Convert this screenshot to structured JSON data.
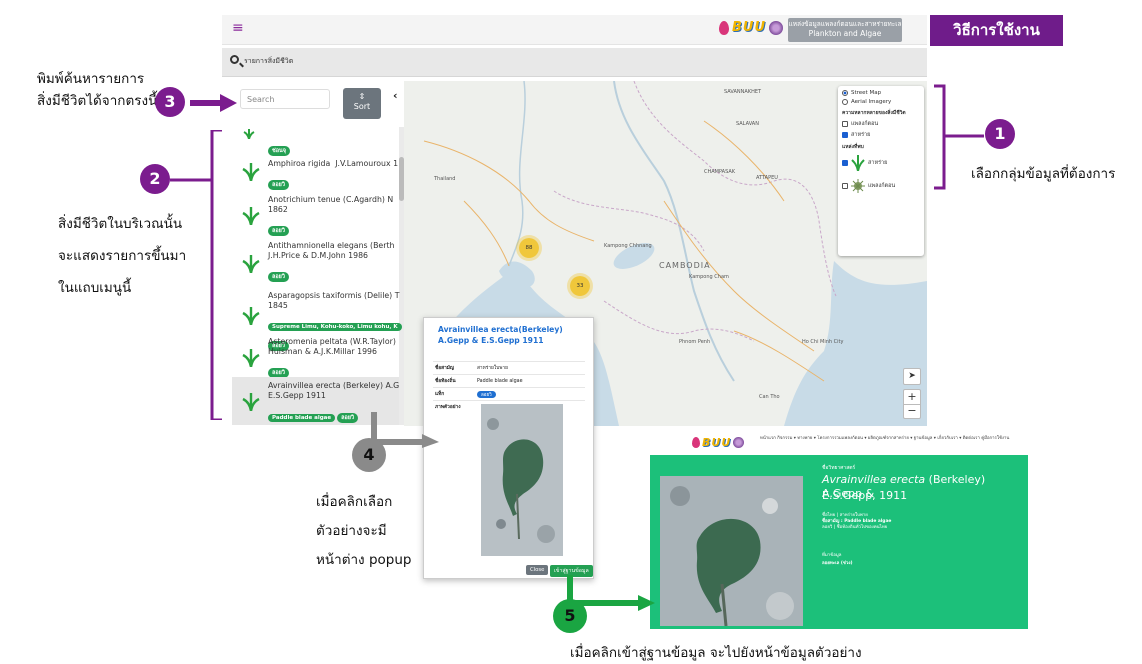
{
  "header": {
    "menu_icon": "hamburger-icon",
    "logo_text": "BUU",
    "db_button_line1": "แหล่งข้อมูลแพลงก์ตอนและสาหร่ายทะเล",
    "db_button_line2": "Plankton and Algae",
    "how_to_title": "วิธีการใช้งาน"
  },
  "search_bar": {
    "label": "รายการสิ่งมีชีวิต"
  },
  "sidebar": {
    "search_placeholder": "Search",
    "sort_icon": "⇕",
    "sort_label": "Sort",
    "collapse_icon": "‹",
    "items": [
      {
        "name": "",
        "tags": [
          "ช่อนจุ"
        ]
      },
      {
        "name": "Amphiroa rigida  J.V.Lamouroux 1",
        "tags": [
          "ลอยวิ"
        ]
      },
      {
        "name": "Anotrichium tenue (C.Agardh) N\n1862",
        "tags": [
          "ลอยวิ"
        ]
      },
      {
        "name": "Antithamnionella elegans (Berth\nJ.H.Price & D.M.John 1986",
        "tags": [
          "ลอยวิ"
        ]
      },
      {
        "name": "Asparagopsis taxiformis (Delile) T\n1845",
        "tags": [
          "Supreme Limu, Kohu-koko, Limu kohu, K",
          "ลอยวิ"
        ]
      },
      {
        "name": "Asteromenia peltata (W.R.Taylor)\nHuisman & A.J.K.Millar 1996",
        "tags": [
          "ลอยวิ"
        ]
      },
      {
        "name": "Avrainvillea erecta (Berkeley) A.G\nE.S.Gepp 1911",
        "tags": [
          "Paddle blade algae",
          "ลอยวิ"
        ]
      }
    ]
  },
  "map": {
    "labels": [
      "SAVANNAKHET",
      "SALAVAN",
      "CHAMPASAK",
      "ATTAPEU",
      "CAMBODIA",
      "Kampong Chhnang",
      "Kampong Cham",
      "Phnom Penh",
      "Ho Chi Minh City",
      "Thailand",
      "Can Tho"
    ],
    "clusters": [
      "88",
      "33"
    ],
    "layer_control": {
      "base_layers": [
        "Street Map",
        "Aerial Imagery"
      ],
      "section_title_1": "ความหลากหลายของสิ่งมีชีวิต",
      "group_options": [
        "แพลงก์ตอน",
        "สาหร่าย"
      ],
      "section_title_2": "แหล่งที่พบ",
      "source_options": [
        "สาหร่าย",
        "แพลงก์ตอน"
      ]
    },
    "locate_icon": "locate-arrow-icon",
    "zoom_in": "+",
    "zoom_out": "−"
  },
  "popup": {
    "title": "Avrainvillea erecta(Berkeley) A.Gepp & E.S.Gepp 1911",
    "rows": [
      {
        "key": "ชื่อสามัญ",
        "value": "สาหร่ายใบพาย"
      },
      {
        "key": "ชื่อท้องถิ่น",
        "value": "Paddle blade algae"
      },
      {
        "key": "แท็ก",
        "value": "ลอยวิ"
      },
      {
        "key": "ภาพตัวอย่าง",
        "value": ""
      }
    ],
    "close_label": "Close",
    "db_label": "เข้าสู่ฐานข้อมูล"
  },
  "detail": {
    "nav_menu": "หน้าแรก   กิจกรรม ▾   ทางพาย ▾   โครงการรวมแพลงก์ตอน ▾   ผลิตภูณฑ์จากสาหร่าย ▾   ฐานข้อมูล ▾   เกี่ยวกับเรา ▾   ติดต่อเรา   คู่มือการใช้งาน",
    "category": "ชื่อวิทยาศาสตร์",
    "species_italic": "Avrainvillea erecta",
    "species_rest": " (Berkeley) A.Gepp &",
    "species_line2": "E.S.Gepp, 1911",
    "info_lines": [
      "ชื่อไทย | สาหร่ายใบพาย",
      "ชื่อสามัญ : Paddle blade algae",
      "ลอยวิ | ชื่อท้องถิ่นทั่วไปของคนไทย"
    ],
    "found_label": "ที่มาข้อมูล",
    "found_value": "ลอยทะเล (ช่วง)"
  },
  "annotations": {
    "n1": "1",
    "n2": "2",
    "n3": "3",
    "n4": "4",
    "n5": "5",
    "text1": "เลือกกลุ่มข้อมูลที่ต้องการ",
    "text2_lines": [
      "สิ่งมีชีวิตในบริเวณนั้น",
      "จะแสดงรายการขึ้นมา",
      "ในแถบเมนูนี้"
    ],
    "text3_lines": [
      "พิมพ์ค้นหารายการ",
      "สิ่งมีชีวิตได้จากตรงนี้"
    ],
    "text4_lines": [
      "เมื่อคลิกเลือก",
      "ตัวอย่างจะมี",
      "หน้าต่าง popup"
    ],
    "text5": "เมื่อคลิกเข้าสู่ฐานข้อมูล จะไปยังหน้าข้อมูลตัวอย่าง"
  },
  "colors": {
    "purple": "#7b1c8e",
    "green": "#1cc07a",
    "tag_green": "#24a053",
    "link_blue": "#1f6fd1",
    "cluster_yellow": "#f0c228"
  }
}
